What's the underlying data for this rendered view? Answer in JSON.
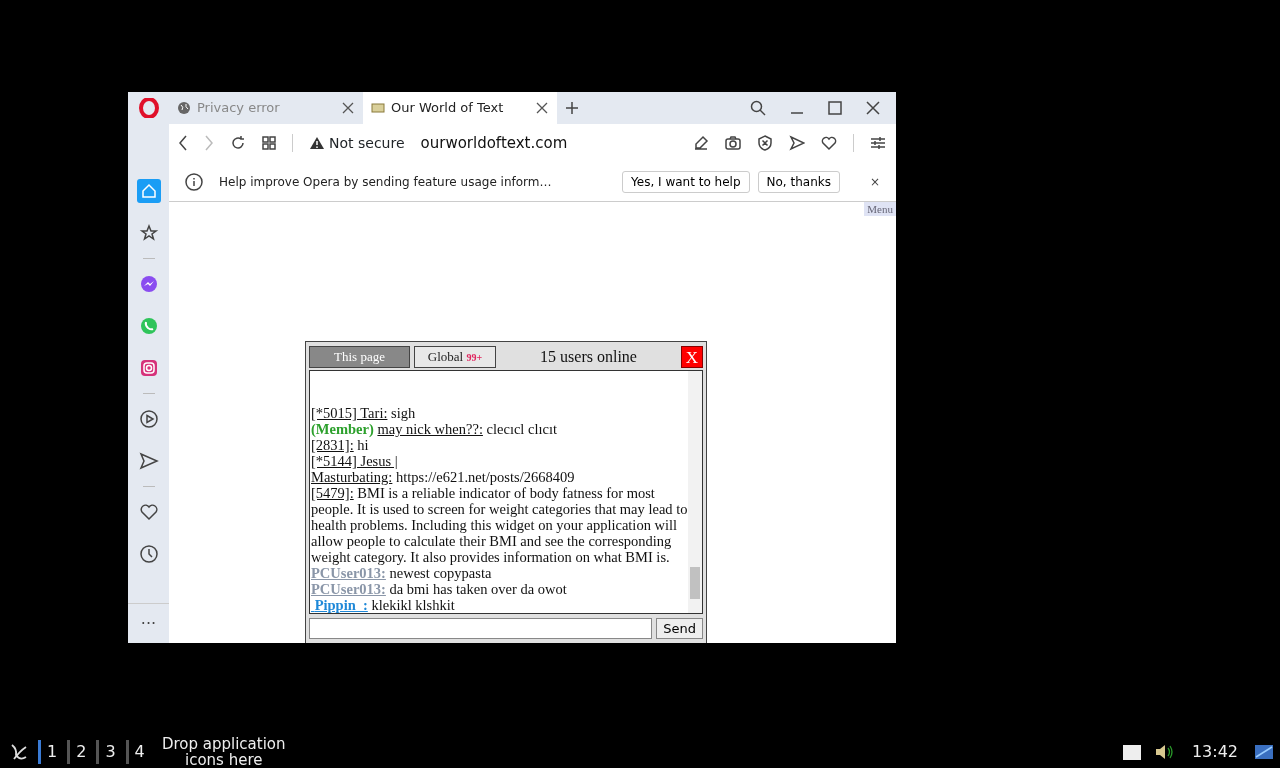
{
  "browser": {
    "tabs": [
      {
        "title": "Privacy error",
        "selected": false
      },
      {
        "title": "Our World of Text",
        "selected": true
      }
    ],
    "security": "Not secure",
    "url": "ourworldoftext.com",
    "infobar": {
      "message": "Help improve Opera by sending feature usage inform…",
      "accept": "Yes, I want to help",
      "decline": "No, thanks",
      "close": "×"
    },
    "sidebar": {
      "items": [
        {
          "kind": "home",
          "selected": true
        },
        {
          "kind": "star",
          "selected": false
        },
        {
          "kind": "messenger",
          "selected": false
        },
        {
          "kind": "whatsapp",
          "selected": false
        },
        {
          "kind": "instagram",
          "selected": false
        },
        {
          "kind": "play",
          "selected": false
        },
        {
          "kind": "send",
          "selected": false
        },
        {
          "kind": "heart",
          "selected": false
        },
        {
          "kind": "clock",
          "selected": false
        }
      ],
      "more": "···"
    }
  },
  "page": {
    "menu": "Menu",
    "chat": {
      "tabs": [
        {
          "label": "This page",
          "selected": true
        },
        {
          "label": "Global",
          "badge": "99+",
          "selected": false
        }
      ],
      "online": "15 users online",
      "close": "X",
      "messages": [
        {
          "name": "[*5015] Tari:",
          "text": "sigh"
        },
        {
          "prefix": "(Member)",
          "color": "#2ca02c",
          "name": "may nick when??:",
          "text": "clecıcl clıcıt"
        },
        {
          "name": "[2831]:",
          "text": "hi"
        },
        {
          "name": "[*5144] Jesus |"
        },
        {
          "name": "Masturbating:",
          "text": "https://e621.net/posts/2668409"
        },
        {
          "name": "[5479]:",
          "text": "BMI is a reliable indicator of body fatness for most people. It is used to screen for weight categories that may lead to health problems. Including this widget on your application will allow people to calculate their BMI and see the corresponding weight category. It also provides information on what BMI is."
        },
        {
          "name": "PCUser013:",
          "color": "#8a96a8",
          "text": "newest copypasta"
        },
        {
          "name": "PCUser013:",
          "color": "#8a96a8",
          "text": "da bmi has taken over da owot"
        },
        {
          "name": " Pippin  :",
          "color": "#1e88d8",
          "text": "klekikl klshkit"
        }
      ],
      "send": "Send"
    }
  },
  "taskbar": {
    "workspaces": [
      {
        "label": "1",
        "selected": true
      },
      {
        "label": "2",
        "selected": false
      },
      {
        "label": "3",
        "selected": false
      },
      {
        "label": "4",
        "selected": false
      }
    ],
    "hint": "Drop application icons here",
    "clock": "13:42"
  }
}
